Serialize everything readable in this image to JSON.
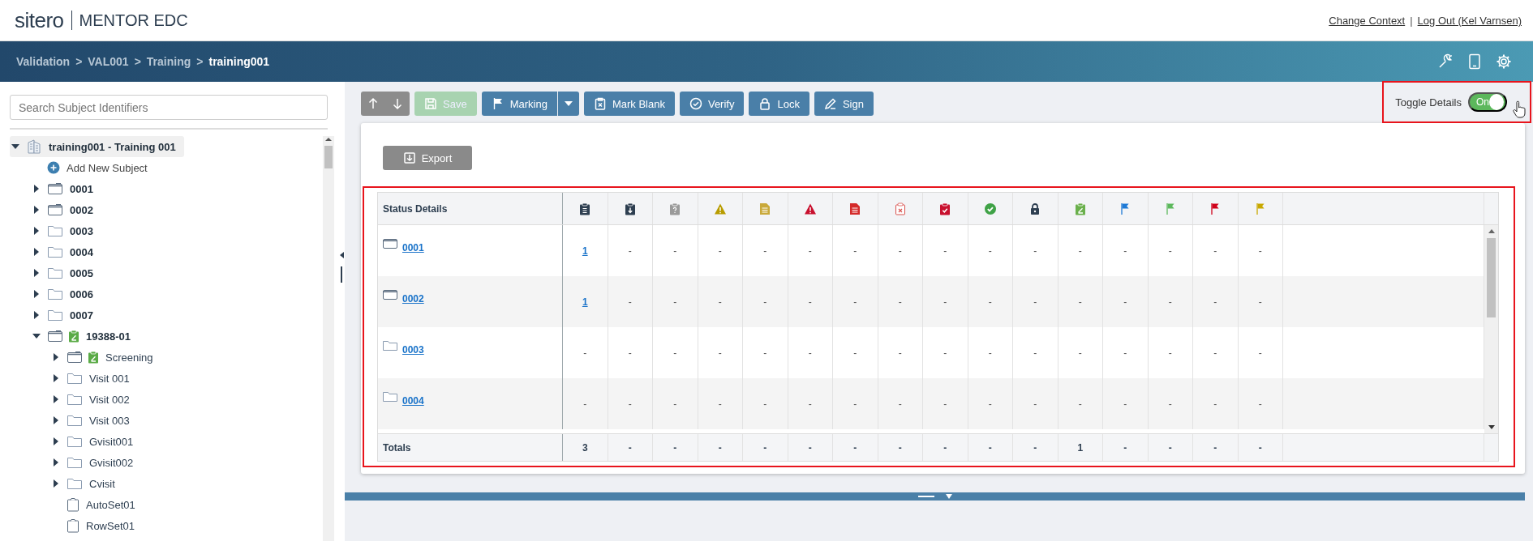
{
  "app": {
    "logo": "sitero",
    "product": "MENTOR EDC",
    "links": [
      "Change Context",
      "Log Out (Kel Varnsen)"
    ],
    "link_separator": "|"
  },
  "breadcrumb": {
    "separator": ">",
    "items": [
      {
        "label": "Validation",
        "current": false
      },
      {
        "label": "VAL001",
        "current": false
      },
      {
        "label": "Training",
        "current": false
      },
      {
        "label": "training001",
        "current": true
      }
    ]
  },
  "sidebar": {
    "search": {
      "placeholder": "Search Subject Identifiers"
    },
    "tree": [
      {
        "kind": "study",
        "label": "training001 - Training 001",
        "expanded": true,
        "selected": true,
        "children": [
          {
            "kind": "action",
            "label": "Add New Subject"
          },
          {
            "kind": "subject",
            "label": "0001",
            "expanded": false,
            "has_data": true,
            "edited": false
          },
          {
            "kind": "subject",
            "label": "0002",
            "expanded": false,
            "has_data": true,
            "edited": false
          },
          {
            "kind": "subject",
            "label": "0003",
            "expanded": false,
            "has_data": false,
            "edited": false
          },
          {
            "kind": "subject",
            "label": "0004",
            "expanded": false,
            "has_data": false,
            "edited": false
          },
          {
            "kind": "subject",
            "label": "0005",
            "expanded": false,
            "has_data": false,
            "edited": false
          },
          {
            "kind": "subject",
            "label": "0006",
            "expanded": false,
            "has_data": false,
            "edited": false
          },
          {
            "kind": "subject",
            "label": "0007",
            "expanded": false,
            "has_data": false,
            "edited": false
          },
          {
            "kind": "subject",
            "label": "19388-01",
            "expanded": true,
            "has_data": true,
            "edited": true,
            "children": [
              {
                "kind": "visit",
                "label": "Screening",
                "expanded": false,
                "has_data": true,
                "edited": true
              },
              {
                "kind": "visit",
                "label": "Visit 001",
                "expanded": false,
                "has_data": false,
                "edited": false
              },
              {
                "kind": "visit",
                "label": "Visit 002",
                "expanded": false,
                "has_data": false,
                "edited": false
              },
              {
                "kind": "visit",
                "label": "Visit 003",
                "expanded": false,
                "has_data": false,
                "edited": false
              },
              {
                "kind": "visit",
                "label": "Gvisit001",
                "expanded": false,
                "has_data": false,
                "edited": false
              },
              {
                "kind": "visit",
                "label": "Gvisit002",
                "expanded": false,
                "has_data": false,
                "edited": false
              },
              {
                "kind": "visit",
                "label": "Cvisit",
                "expanded": false,
                "has_data": false,
                "edited": false
              },
              {
                "kind": "form",
                "label": "AutoSet01"
              },
              {
                "kind": "form",
                "label": "RowSet01"
              }
            ]
          }
        ]
      }
    ]
  },
  "toolbar": {
    "buttons": [
      {
        "kind": "up",
        "disabled": false
      },
      {
        "kind": "down",
        "disabled": false
      },
      {
        "kind": "save",
        "label": "Save",
        "disabled": true
      },
      {
        "kind": "marking",
        "label": "Marking",
        "disabled": false
      },
      {
        "kind": "mark-blank",
        "label": "Mark Blank",
        "disabled": false
      },
      {
        "kind": "verify",
        "label": "Verify",
        "disabled": false
      },
      {
        "kind": "lock",
        "label": "Lock",
        "disabled": false
      },
      {
        "kind": "sign",
        "label": "Sign",
        "disabled": false
      }
    ],
    "toggle": {
      "label": "Toggle Details",
      "text": "On",
      "on": true,
      "highlighted": true
    }
  },
  "status_table": {
    "highlighted": true,
    "export": "Export",
    "heading": "Status Details",
    "rows": [
      {
        "subject": "0001",
        "has_data": true,
        "cells": [
          {
            "text": "1",
            "link": true
          },
          {
            "text": "-",
            "link": false
          },
          {
            "text": "-",
            "link": false
          },
          {
            "text": "-",
            "link": false
          },
          {
            "text": "-",
            "link": false
          },
          {
            "text": "-",
            "link": false
          },
          {
            "text": "-",
            "link": false
          },
          {
            "text": "-",
            "link": false
          },
          {
            "text": "-",
            "link": false
          },
          {
            "text": "-",
            "link": false
          },
          {
            "text": "-",
            "link": false
          },
          {
            "text": "-",
            "link": false
          },
          {
            "text": "-",
            "link": false
          },
          {
            "text": "-",
            "link": false
          },
          {
            "text": "-",
            "link": false
          },
          {
            "text": "-",
            "link": false
          }
        ]
      },
      {
        "subject": "0002",
        "has_data": true,
        "cells": [
          {
            "text": "1",
            "link": true
          },
          {
            "text": "-",
            "link": false
          },
          {
            "text": "-",
            "link": false
          },
          {
            "text": "-",
            "link": false
          },
          {
            "text": "-",
            "link": false
          },
          {
            "text": "-",
            "link": false
          },
          {
            "text": "-",
            "link": false
          },
          {
            "text": "-",
            "link": false
          },
          {
            "text": "-",
            "link": false
          },
          {
            "text": "-",
            "link": false
          },
          {
            "text": "-",
            "link": false
          },
          {
            "text": "-",
            "link": false
          },
          {
            "text": "-",
            "link": false
          },
          {
            "text": "-",
            "link": false
          },
          {
            "text": "-",
            "link": false
          },
          {
            "text": "-",
            "link": false
          }
        ]
      },
      {
        "subject": "0003",
        "has_data": false,
        "cells": [
          {
            "text": "-",
            "link": false
          },
          {
            "text": "-",
            "link": false
          },
          {
            "text": "-",
            "link": false
          },
          {
            "text": "-",
            "link": false
          },
          {
            "text": "-",
            "link": false
          },
          {
            "text": "-",
            "link": false
          },
          {
            "text": "-",
            "link": false
          },
          {
            "text": "-",
            "link": false
          },
          {
            "text": "-",
            "link": false
          },
          {
            "text": "-",
            "link": false
          },
          {
            "text": "-",
            "link": false
          },
          {
            "text": "-",
            "link": false
          },
          {
            "text": "-",
            "link": false
          },
          {
            "text": "-",
            "link": false
          },
          {
            "text": "-",
            "link": false
          },
          {
            "text": "-",
            "link": false
          }
        ]
      },
      {
        "subject": "0004",
        "has_data": false,
        "cells": [
          {
            "text": "-",
            "link": false
          },
          {
            "text": "-",
            "link": false
          },
          {
            "text": "-",
            "link": false
          },
          {
            "text": "-",
            "link": false
          },
          {
            "text": "-",
            "link": false
          },
          {
            "text": "-",
            "link": false
          },
          {
            "text": "-",
            "link": false
          },
          {
            "text": "-",
            "link": false
          },
          {
            "text": "-",
            "link": false
          },
          {
            "text": "-",
            "link": false
          },
          {
            "text": "-",
            "link": false
          },
          {
            "text": "-",
            "link": false
          },
          {
            "text": "-",
            "link": false
          },
          {
            "text": "-",
            "link": false
          },
          {
            "text": "-",
            "link": false
          },
          {
            "text": "-",
            "link": false
          }
        ]
      }
    ],
    "totals": {
      "label": "Totals",
      "cells": [
        "3",
        "-",
        "-",
        "-",
        "-",
        "-",
        "-",
        "-",
        "-",
        "-",
        "-",
        "1",
        "-",
        "-",
        "-",
        "-"
      ]
    }
  }
}
